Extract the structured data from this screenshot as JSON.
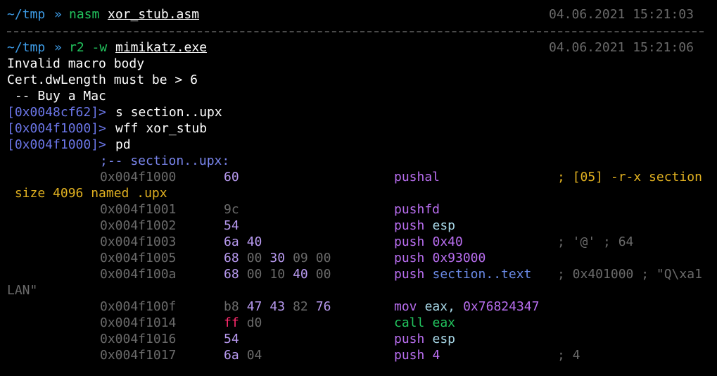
{
  "commands": [
    {
      "prompt_dir": "~/tmp",
      "prompt_sep": "»",
      "program": "nasm",
      "args": "xor_stub.asm",
      "timestamp": "04.06.2021 15:21:03"
    },
    {
      "prompt_dir": "~/tmp",
      "prompt_sep": "»",
      "program": "r2 -w",
      "args": "mimikatz.exe",
      "timestamp": "04.06.2021 15:21:06"
    }
  ],
  "output_lines": [
    "Invalid macro body",
    "Cert.dwLength must be > 6",
    " -- Buy a Mac"
  ],
  "r2_commands": [
    {
      "prompt": "[0x0048cf62]>",
      "input": "s section..upx"
    },
    {
      "prompt": "[0x004f1000]>",
      "input": "wff xor_stub"
    },
    {
      "prompt": "[0x004f1000]>",
      "input": "pd"
    }
  ],
  "disasm": {
    "flag": ";-- section..upx:",
    "rows": [
      {
        "addr": "0x004f1000",
        "bytes": [
          {
            "t": "60",
            "c": "a"
          }
        ],
        "mnemonic": "pushal",
        "operand": "",
        "operand_kind": "",
        "comment": "; [05] -r-x section",
        "comment_kind": "yel",
        "wrap": " size 4096 named .upx",
        "wrap_kind": "yel"
      },
      {
        "addr": "0x004f1001",
        "bytes": [
          {
            "t": "9c",
            "c": "d"
          }
        ],
        "mnemonic": "pushfd",
        "operand": "",
        "operand_kind": "",
        "comment": "",
        "comment_kind": "",
        "wrap": "",
        "wrap_kind": ""
      },
      {
        "addr": "0x004f1002",
        "bytes": [
          {
            "t": "54",
            "c": "a"
          }
        ],
        "mnemonic": "push",
        "operand": "esp",
        "operand_kind": "reg",
        "comment": "",
        "comment_kind": "",
        "wrap": "",
        "wrap_kind": ""
      },
      {
        "addr": "0x004f1003",
        "bytes": [
          {
            "t": "6a",
            "c": "a"
          },
          {
            "t": "40",
            "c": "a"
          }
        ],
        "mnemonic": "push",
        "operand": "0x40",
        "operand_kind": "imm",
        "comment": "; '@' ; 64",
        "comment_kind": "cmt",
        "wrap": "",
        "wrap_kind": ""
      },
      {
        "addr": "0x004f1005",
        "bytes": [
          {
            "t": "68",
            "c": "a"
          },
          {
            "t": "00",
            "c": "d"
          },
          {
            "t": "30",
            "c": "a"
          },
          {
            "t": "09",
            "c": "d"
          },
          {
            "t": "00",
            "c": "d"
          }
        ],
        "mnemonic": "push",
        "operand": "0x93000",
        "operand_kind": "imm",
        "comment": "",
        "comment_kind": "",
        "wrap": "",
        "wrap_kind": ""
      },
      {
        "addr": "0x004f100a",
        "bytes": [
          {
            "t": "68",
            "c": "a"
          },
          {
            "t": "00",
            "c": "d"
          },
          {
            "t": "10",
            "c": "d"
          },
          {
            "t": "40",
            "c": "a"
          },
          {
            "t": "00",
            "c": "d"
          }
        ],
        "mnemonic": "push",
        "operand": "section..text",
        "operand_kind": "sym",
        "comment": "; 0x401000 ; \"Q\\xa1",
        "comment_kind": "cmt",
        "wrap": "LAN\"",
        "wrap_kind": "cmt"
      },
      {
        "addr": "0x004f100f",
        "bytes": [
          {
            "t": "b8",
            "c": "d"
          },
          {
            "t": "47",
            "c": "a"
          },
          {
            "t": "43",
            "c": "a"
          },
          {
            "t": "82",
            "c": "d"
          },
          {
            "t": "76",
            "c": "a"
          }
        ],
        "mnemonic": "mov",
        "operand": "eax, 0x76824347",
        "operand_kind": "mov",
        "comment": "",
        "comment_kind": "",
        "wrap": "",
        "wrap_kind": ""
      },
      {
        "addr": "0x004f1014",
        "bytes": [
          {
            "t": "ff",
            "c": "r"
          },
          {
            "t": "d0",
            "c": "d"
          }
        ],
        "mnemonic": "call",
        "operand": "eax",
        "operand_kind": "call",
        "comment": "",
        "comment_kind": "",
        "wrap": "",
        "wrap_kind": ""
      },
      {
        "addr": "0x004f1016",
        "bytes": [
          {
            "t": "54",
            "c": "a"
          }
        ],
        "mnemonic": "push",
        "operand": "esp",
        "operand_kind": "reg",
        "comment": "",
        "comment_kind": "",
        "wrap": "",
        "wrap_kind": ""
      },
      {
        "addr": "0x004f1017",
        "bytes": [
          {
            "t": "6a",
            "c": "a"
          },
          {
            "t": "04",
            "c": "d"
          }
        ],
        "mnemonic": "push",
        "operand": "4",
        "operand_kind": "imm",
        "comment": "; 4",
        "comment_kind": "cmt",
        "wrap": "",
        "wrap_kind": ""
      }
    ]
  },
  "colors": {
    "background": "#000000",
    "prompt_dir": "#3d9be6",
    "command": "#22c55e",
    "r2_prompt": "#6b76e8",
    "address": "#6a6a6a",
    "mnemonic": "#b96ef0",
    "comment_section": "#e0b020"
  }
}
